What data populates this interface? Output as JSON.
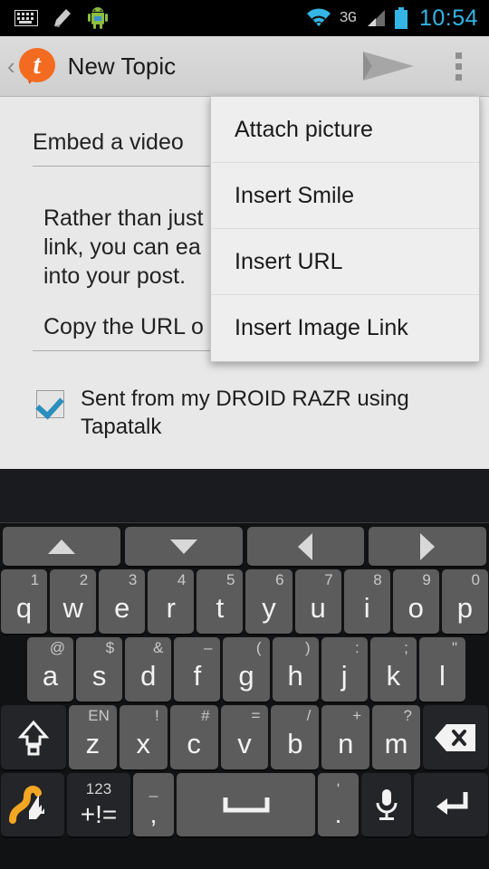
{
  "statusbar": {
    "left_icons": [
      "keyboard-icon",
      "broom-icon",
      "android-robot-icon"
    ],
    "right_icons": [
      "wifi-icon",
      "network-3g-icon",
      "signal-bars-icon",
      "battery-icon"
    ],
    "network_label": "3G",
    "clock": "10:54",
    "accent_color": "#33b5e5"
  },
  "actionbar": {
    "back_label": "‹",
    "logo_letter": "t",
    "title": "New Topic",
    "send_label": "send-icon",
    "overflow_label": "overflow-icon",
    "brand_color": "#f26b21"
  },
  "content": {
    "title_field_value": "Embed a video",
    "body_text": "Rather than just\nlink, you can ea\ninto your post.",
    "sub_field_value": "Copy the URL o",
    "signature_checked": true,
    "signature_text": "Sent from my DROID RAZR using Tapatalk"
  },
  "menu": {
    "items": [
      {
        "label": "Attach picture"
      },
      {
        "label": "Insert Smile"
      },
      {
        "label": "Insert URL"
      },
      {
        "label": "Insert Image Link"
      }
    ]
  },
  "keyboard": {
    "nav": [
      {
        "name": "arrow-up",
        "glyph": "up"
      },
      {
        "name": "arrow-down",
        "glyph": "down"
      },
      {
        "name": "arrow-left",
        "glyph": "left"
      },
      {
        "name": "arrow-right",
        "glyph": "right"
      }
    ],
    "row1": [
      {
        "main": "q",
        "sup": "1"
      },
      {
        "main": "w",
        "sup": "2"
      },
      {
        "main": "e",
        "sup": "3"
      },
      {
        "main": "r",
        "sup": "4"
      },
      {
        "main": "t",
        "sup": "5"
      },
      {
        "main": "y",
        "sup": "6"
      },
      {
        "main": "u",
        "sup": "7"
      },
      {
        "main": "i",
        "sup": "8"
      },
      {
        "main": "o",
        "sup": "9"
      },
      {
        "main": "p",
        "sup": "0"
      }
    ],
    "row2": [
      {
        "main": "a",
        "sup": "@"
      },
      {
        "main": "s",
        "sup": "$"
      },
      {
        "main": "d",
        "sup": "&"
      },
      {
        "main": "f",
        "sup": "–"
      },
      {
        "main": "g",
        "sup": "("
      },
      {
        "main": "h",
        "sup": ")"
      },
      {
        "main": "j",
        "sup": ":"
      },
      {
        "main": "k",
        "sup": ";"
      },
      {
        "main": "l",
        "sup": "\""
      }
    ],
    "row3": [
      {
        "main": "z",
        "sup": "EN"
      },
      {
        "main": "x",
        "sup": "!"
      },
      {
        "main": "c",
        "sup": "#"
      },
      {
        "main": "v",
        "sup": "="
      },
      {
        "main": "b",
        "sup": "/"
      },
      {
        "main": "n",
        "sup": "+"
      },
      {
        "main": "m",
        "sup": "?"
      }
    ],
    "shift_label": "shift-icon",
    "backspace_label": "backspace-icon",
    "row4": {
      "swype_label": "swype-gesture-icon",
      "symbols_top": "123",
      "symbols_bottom": "+!=",
      "comma_top": "_",
      "comma_bottom": ",",
      "space_label": "space-icon",
      "period_top": "'",
      "period_bottom": ".",
      "mic_label": "microphone-icon",
      "enter_label": "enter-icon"
    }
  }
}
